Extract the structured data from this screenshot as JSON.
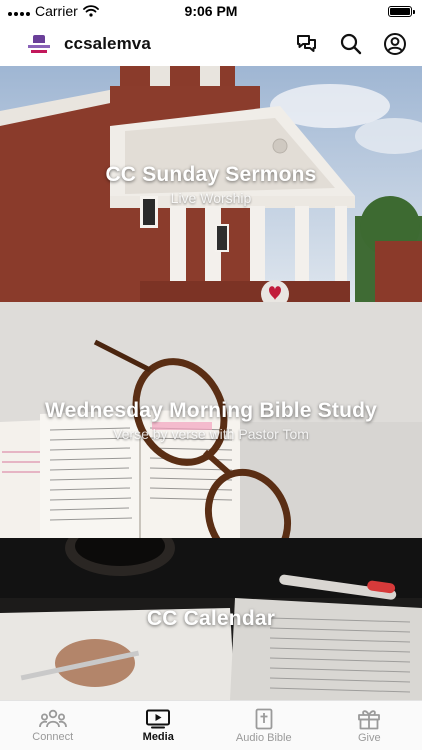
{
  "status_bar": {
    "carrier": "Carrier",
    "time": "9:06 PM",
    "battery_level": 1.0
  },
  "header": {
    "title": "ccsalemva",
    "icons": [
      "chat-bubbles-icon",
      "search-icon",
      "profile-icon"
    ]
  },
  "cards": [
    {
      "title": "CC Sunday Sermons",
      "subtitle": "Live Worship"
    },
    {
      "title": "Wednesday Morning Bible Study",
      "subtitle": "Verse by verse with Pastor Tom"
    },
    {
      "title": "CC Calendar",
      "subtitle": ""
    }
  ],
  "tabs": [
    {
      "label": "Connect",
      "icon": "people-icon",
      "active": false
    },
    {
      "label": "Media",
      "icon": "play-icon",
      "active": true
    },
    {
      "label": "Audio Bible",
      "icon": "bible-icon",
      "active": false
    },
    {
      "label": "Give",
      "icon": "gift-icon",
      "active": false
    }
  ],
  "colors": {
    "active_tab": "#111111",
    "inactive_tab": "#9a9a9a"
  }
}
